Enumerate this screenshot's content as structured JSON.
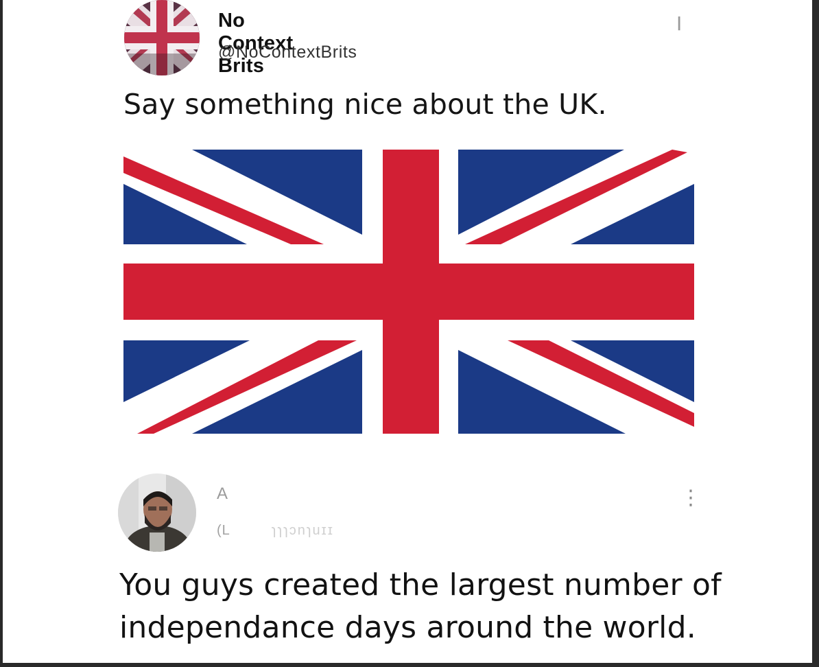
{
  "post": {
    "author": {
      "display_name": "No Context Brits",
      "handle": "@NoContextBrits",
      "avatar": "union-jack-avatar"
    },
    "menu_glyph": "I",
    "text": "Say something nice about the UK.",
    "image": "union-jack-flag",
    "colors": {
      "blue": "#1b3a86",
      "red": "#d21f34",
      "white": "#ffffff"
    }
  },
  "reply": {
    "author": {
      "display_name": "A",
      "handle": "(L",
      "handle_faint": "ɿɿɿɔnɿuɪɪ",
      "avatar": "man-with-beard-avatar"
    },
    "menu_glyph": "⋮",
    "text_lines": [
      "You guys created the largest number of",
      "independance days around the world."
    ]
  }
}
